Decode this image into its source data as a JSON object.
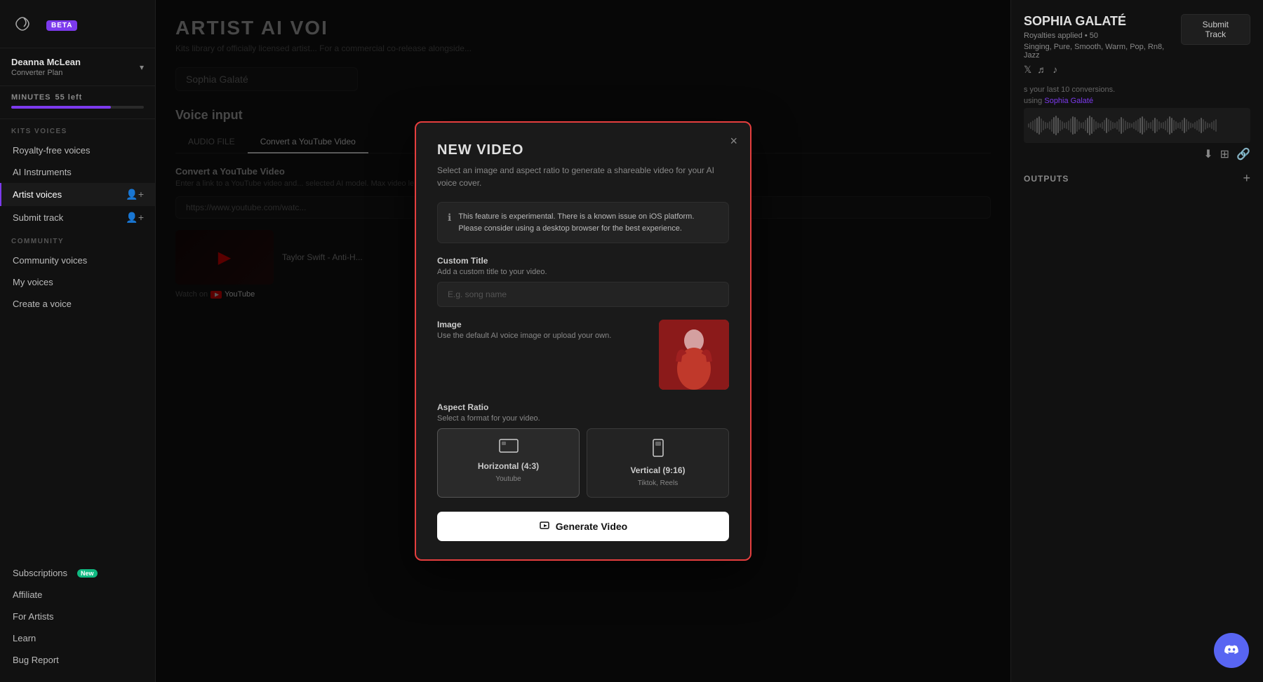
{
  "app": {
    "beta_label": "BETA",
    "logo_alt": "Kits AI Logo"
  },
  "sidebar": {
    "user": {
      "name": "Deanna McLean",
      "plan": "Converter Plan"
    },
    "minutes": {
      "label": "MINUTES",
      "left": "55 left",
      "percent": 75
    },
    "kits_voices_label": "KITS VOICES",
    "nav_items": [
      {
        "id": "royalty-free",
        "label": "Royalty-free voices",
        "active": false
      },
      {
        "id": "ai-instruments",
        "label": "AI Instruments",
        "active": false
      },
      {
        "id": "artist-voices",
        "label": "Artist voices",
        "active": true,
        "has_icon": true
      },
      {
        "id": "submit-track",
        "label": "Submit track",
        "active": false,
        "has_icon": true
      }
    ],
    "community_label": "COMMUNITY",
    "community_items": [
      {
        "id": "community-voices",
        "label": "Community voices"
      },
      {
        "id": "my-voices",
        "label": "My voices"
      },
      {
        "id": "create-voice",
        "label": "Create a voice"
      }
    ],
    "footer_items": [
      {
        "id": "subscriptions",
        "label": "Subscriptions",
        "badge": "New"
      },
      {
        "id": "affiliate",
        "label": "Affiliate"
      },
      {
        "id": "for-artists",
        "label": "For Artists"
      },
      {
        "id": "learn",
        "label": "Learn"
      },
      {
        "id": "bug-report",
        "label": "Bug Report"
      }
    ]
  },
  "main": {
    "page_title": "ARTIST AI VOI",
    "page_subtitle": "Kits library of officially licensed artist... For a commercial co-release alongside...",
    "voice_search_placeholder": "Sophia Galaté",
    "voice_input_label": "Voice input",
    "tabs": [
      "AUDIO FILE",
      "Convert a YouTube Video"
    ],
    "active_tab": 1,
    "yt_section": {
      "title": "Convert a YouTube Video",
      "desc": "Enter a link to a YouTube video and... selected AI model. Max video lengt...",
      "input_placeholder": "https://www.youtube.com/watc...",
      "video_title": "Taylor Swift - Anti-H...",
      "watch_on_label": "Watch on"
    }
  },
  "right_panel": {
    "artist_name": "SOPHIA GALATÉ",
    "royalties_label": "Royalties applied • 50",
    "tags": "Singing, Pure, Smooth, Warm, Pop, Rn8, Jazz",
    "submit_track_label": "Submit Track",
    "track_info_prefix": "s your last 10 conversions.",
    "track_using": "using",
    "track_artist": "Sophia Galaté",
    "outputs_label": "OUTPUTS"
  },
  "modal": {
    "title": "NEW VIDEO",
    "subtitle": "Select an image and aspect ratio to generate a shareable video for your AI voice cover.",
    "close_label": "×",
    "info_text": "This feature is experimental. There is a known issue on iOS platform. Please consider using a desktop browser for the best experience.",
    "custom_title_label": "Custom Title",
    "custom_title_sublabel": "Add a custom title to your video.",
    "custom_title_placeholder": "E.g. song name",
    "image_label": "Image",
    "image_sublabel": "Use the default AI voice image or upload your own.",
    "aspect_label": "Aspect Ratio",
    "aspect_sublabel": "Select a format for your video.",
    "aspect_options": [
      {
        "id": "horizontal",
        "label": "Horizontal (4:3)",
        "sub": "Youtube",
        "selected": true
      },
      {
        "id": "vertical",
        "label": "Vertical (9:16)",
        "sub": "Tiktok, Reels",
        "selected": false
      }
    ],
    "generate_btn_label": "Generate Video"
  }
}
